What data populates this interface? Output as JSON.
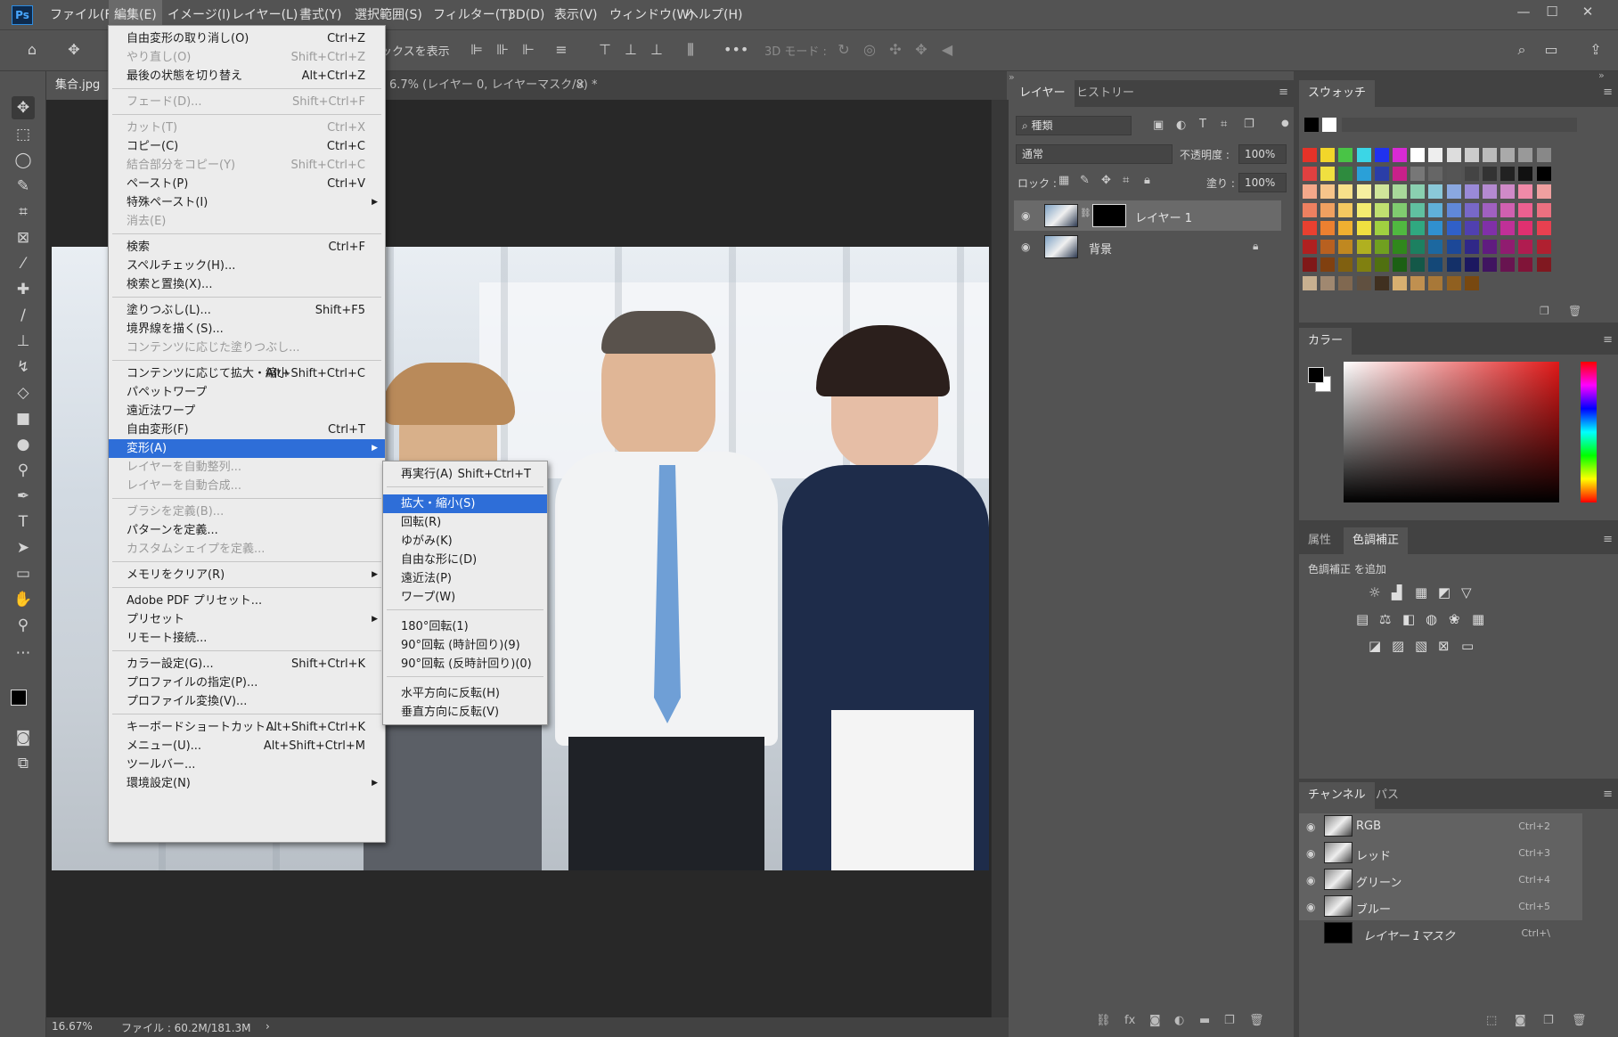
{
  "menubar": {
    "items": [
      "ファイル(F)",
      "編集(E)",
      "イメージ(I)",
      "レイヤー(L)",
      "書式(Y)",
      "選択範囲(S)",
      "フィルター(T)",
      "3D(D)",
      "表示(V)",
      "ウィンドウ(W)",
      "ヘルプ(H)"
    ]
  },
  "app": {
    "logo": "Ps"
  },
  "options": {
    "show_transform": "ックスを表示",
    "mode3d": "3D モード :"
  },
  "tabs": {
    "doc1": "集合.jpg",
    "doc2_title": "6.7% (レイヤー 0, レイヤーマスク/8) *",
    "close": "×"
  },
  "edit_menu": {
    "items": [
      {
        "label": "自由変形の取り消し(O)",
        "shortcut": "Ctrl+Z",
        "disabled": false
      },
      {
        "label": "やり直し(O)",
        "shortcut": "Shift+Ctrl+Z",
        "disabled": true
      },
      {
        "label": "最後の状態を切り替え",
        "shortcut": "Alt+Ctrl+Z",
        "disabled": false
      },
      {
        "label": "フェード(D)...",
        "shortcut": "Shift+Ctrl+F",
        "disabled": true
      },
      {
        "label": "カット(T)",
        "shortcut": "Ctrl+X",
        "disabled": true
      },
      {
        "label": "コピー(C)",
        "shortcut": "Ctrl+C",
        "disabled": false
      },
      {
        "label": "結合部分をコピー(Y)",
        "shortcut": "Shift+Ctrl+C",
        "disabled": true
      },
      {
        "label": "ペースト(P)",
        "shortcut": "Ctrl+V",
        "disabled": false
      },
      {
        "label": "特殊ペースト(I)",
        "shortcut": "",
        "disabled": false,
        "submenu": true
      },
      {
        "label": "消去(E)",
        "shortcut": "",
        "disabled": true
      },
      {
        "label": "検索",
        "shortcut": "Ctrl+F",
        "disabled": false
      },
      {
        "label": "スペルチェック(H)...",
        "shortcut": "",
        "disabled": false
      },
      {
        "label": "検索と置換(X)...",
        "shortcut": "",
        "disabled": false
      },
      {
        "label": "塗りつぶし(L)...",
        "shortcut": "Shift+F5",
        "disabled": false
      },
      {
        "label": "境界線を描く(S)...",
        "shortcut": "",
        "disabled": false
      },
      {
        "label": "コンテンツに応じた塗りつぶし...",
        "shortcut": "",
        "disabled": true
      },
      {
        "label": "コンテンツに応じて拡大・縮小",
        "shortcut": "Alt+Shift+Ctrl+C",
        "disabled": false
      },
      {
        "label": "パペットワープ",
        "shortcut": "",
        "disabled": false
      },
      {
        "label": "遠近法ワープ",
        "shortcut": "",
        "disabled": false
      },
      {
        "label": "自由変形(F)",
        "shortcut": "Ctrl+T",
        "disabled": false
      },
      {
        "label": "変形(A)",
        "shortcut": "",
        "disabled": false,
        "submenu": true,
        "highlighted": true
      },
      {
        "label": "レイヤーを自動整列...",
        "shortcut": "",
        "disabled": true
      },
      {
        "label": "レイヤーを自動合成...",
        "shortcut": "",
        "disabled": true
      },
      {
        "label": "ブラシを定義(B)...",
        "shortcut": "",
        "disabled": true
      },
      {
        "label": "パターンを定義...",
        "shortcut": "",
        "disabled": false
      },
      {
        "label": "カスタムシェイプを定義...",
        "shortcut": "",
        "disabled": true
      },
      {
        "label": "メモリをクリア(R)",
        "shortcut": "",
        "disabled": false,
        "submenu": true
      },
      {
        "label": "Adobe PDF プリセット...",
        "shortcut": "",
        "disabled": false
      },
      {
        "label": "プリセット",
        "shortcut": "",
        "disabled": false,
        "submenu": true
      },
      {
        "label": "リモート接続...",
        "shortcut": "",
        "disabled": false
      },
      {
        "label": "カラー設定(G)...",
        "shortcut": "Shift+Ctrl+K",
        "disabled": false
      },
      {
        "label": "プロファイルの指定(P)...",
        "shortcut": "",
        "disabled": false
      },
      {
        "label": "プロファイル変換(V)...",
        "shortcut": "",
        "disabled": false
      },
      {
        "label": "キーボードショートカット...",
        "shortcut": "Alt+Shift+Ctrl+K",
        "disabled": false
      },
      {
        "label": "メニュー(U)...",
        "shortcut": "Alt+Shift+Ctrl+M",
        "disabled": false
      },
      {
        "label": "ツールバー...",
        "shortcut": "",
        "disabled": false
      },
      {
        "label": "環境設定(N)",
        "shortcut": "",
        "disabled": false,
        "submenu": true
      }
    ]
  },
  "transform_menu": {
    "items": [
      {
        "label": "再実行(A)",
        "shortcut": "Shift+Ctrl+T"
      },
      {
        "label": "拡大・縮小(S)",
        "shortcut": "",
        "highlighted": true
      },
      {
        "label": "回転(R)",
        "shortcut": ""
      },
      {
        "label": "ゆがみ(K)",
        "shortcut": ""
      },
      {
        "label": "自由な形に(D)",
        "shortcut": ""
      },
      {
        "label": "遠近法(P)",
        "shortcut": ""
      },
      {
        "label": "ワープ(W)",
        "shortcut": ""
      },
      {
        "label": "180°回転(1)",
        "shortcut": ""
      },
      {
        "label": "90°回転 (時計回り)(9)",
        "shortcut": ""
      },
      {
        "label": "90°回転 (反時計回り)(0)",
        "shortcut": ""
      },
      {
        "label": "水平方向に反転(H)",
        "shortcut": ""
      },
      {
        "label": "垂直方向に反転(V)",
        "shortcut": ""
      }
    ]
  },
  "layers_panel": {
    "tab_layers": "レイヤー",
    "tab_history": "ヒストリー",
    "filter_kind": "種類",
    "blend_mode": "通常",
    "opacity_label": "不透明度 :",
    "opacity": "100%",
    "lock_label": "ロック :",
    "fill_label": "塗り :",
    "fill": "100%",
    "layers": [
      {
        "name": "レイヤー 1"
      },
      {
        "name": "背景"
      }
    ]
  },
  "swatches_panel": {
    "tab": "スウォッチ",
    "colors": [
      "#e63228",
      "#f2d62a",
      "#49c446",
      "#3bd6e6",
      "#2032ef",
      "#d82ad4",
      "#ffffff",
      "#eeeeee",
      "#dddddd",
      "#cccccc",
      "#bbbbbb",
      "#aaaaaa",
      "#999999",
      "#888888",
      "#e04040",
      "#f0e040",
      "#2e8b3e",
      "#2aa0d8",
      "#2a3ea8",
      "#c8208a",
      "#777777",
      "#666666",
      "#555555",
      "#444444",
      "#333333",
      "#222222",
      "#111111",
      "#000000",
      "#f4a88a",
      "#f6c48a",
      "#f8e08a",
      "#f6f0a0",
      "#d0e69a",
      "#a8d89a",
      "#8ad0b0",
      "#8ac8d8",
      "#8aa8e0",
      "#9a8ad8",
      "#b48ad0",
      "#d08ac8",
      "#f08aa8",
      "#f0a0a0",
      "#ee8060",
      "#f0a060",
      "#f4c860",
      "#f4ec70",
      "#c0e070",
      "#80cc70",
      "#60c0a0",
      "#60b0d8",
      "#6088d8",
      "#7868c8",
      "#a060c0",
      "#d060b0",
      "#ec6090",
      "#ec7080",
      "#e84030",
      "#ec8030",
      "#f0b030",
      "#f0e040",
      "#a0d040",
      "#50b840",
      "#30a880",
      "#3090d0",
      "#3060c8",
      "#5040b0",
      "#8030a8",
      "#c03098",
      "#e03070",
      "#e84050",
      "#b02020",
      "#b86020",
      "#c08820",
      "#b0b020",
      "#70a020",
      "#30881c",
      "#1c8060",
      "#1c68a0",
      "#1c4898",
      "#302888",
      "#601c80",
      "#901c70",
      "#b01c50",
      "#b02030",
      "#801818",
      "#804010",
      "#806010",
      "#808010",
      "#507010",
      "#1c6014",
      "#145848",
      "#144878",
      "#143068",
      "#1c1860",
      "#401460",
      "#681450",
      "#801438",
      "#801820",
      "#c8b090",
      "#a08870",
      "#806850",
      "#605040",
      "#403020",
      "#d8b070",
      "#c09050",
      "#a87838",
      "#906020",
      "#784810"
    ]
  },
  "color_panel": {
    "tab": "カラー"
  },
  "adjustments_panel": {
    "tab_properties": "属性",
    "tab_adjustments": "色調補正",
    "add_label": "色調補正 を追加"
  },
  "channels_panel": {
    "tab_channels": "チャンネル",
    "tab_paths": "パス",
    "channels": [
      {
        "name": "RGB",
        "shortcut": "Ctrl+2"
      },
      {
        "name": "レッド",
        "shortcut": "Ctrl+3"
      },
      {
        "name": "グリーン",
        "shortcut": "Ctrl+4"
      },
      {
        "name": "ブルー",
        "shortcut": "Ctrl+5"
      },
      {
        "name": "レイヤー 1マスク",
        "shortcut": "Ctrl+\\"
      }
    ]
  },
  "status": {
    "zoom": "16.67%",
    "file": "ファイル : 60.2M/181.3M",
    "arrow": "›"
  },
  "accent": "#2e6ed8"
}
